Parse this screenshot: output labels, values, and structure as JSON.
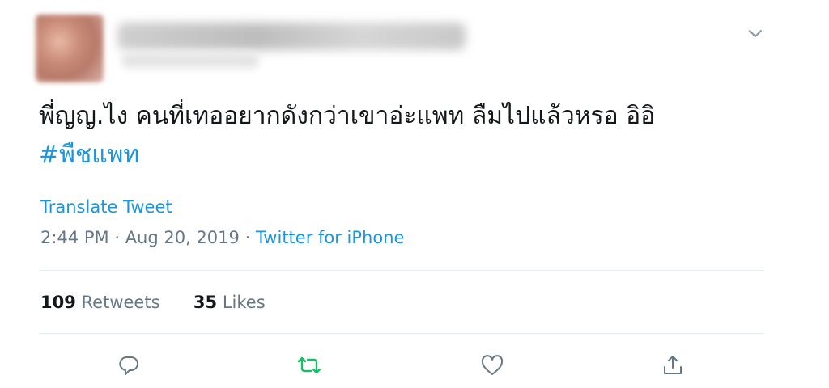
{
  "tweet": {
    "text": "พี่ญญ.ไง คนที่เทออยากดังกว่าเขาอ่ะแพท ลืมไปแล้วหรอ อิอิ",
    "hashtag": "#พืชแพท",
    "translate_label": "Translate Tweet",
    "time": "2:44 PM",
    "date": "Aug 20, 2019",
    "separator": "·",
    "source": "Twitter for iPhone"
  },
  "stats": {
    "retweets_count": "109",
    "retweets_label": "Retweets",
    "likes_count": "35",
    "likes_label": "Likes"
  },
  "icons": {
    "menu": "chevron-down-icon",
    "reply": "reply-icon",
    "retweet": "retweet-icon",
    "like": "heart-icon",
    "share": "share-icon"
  },
  "colors": {
    "link": "#1b95e0",
    "retweet_active": "#17bf63",
    "muted": "#657786",
    "text": "#14171a"
  }
}
